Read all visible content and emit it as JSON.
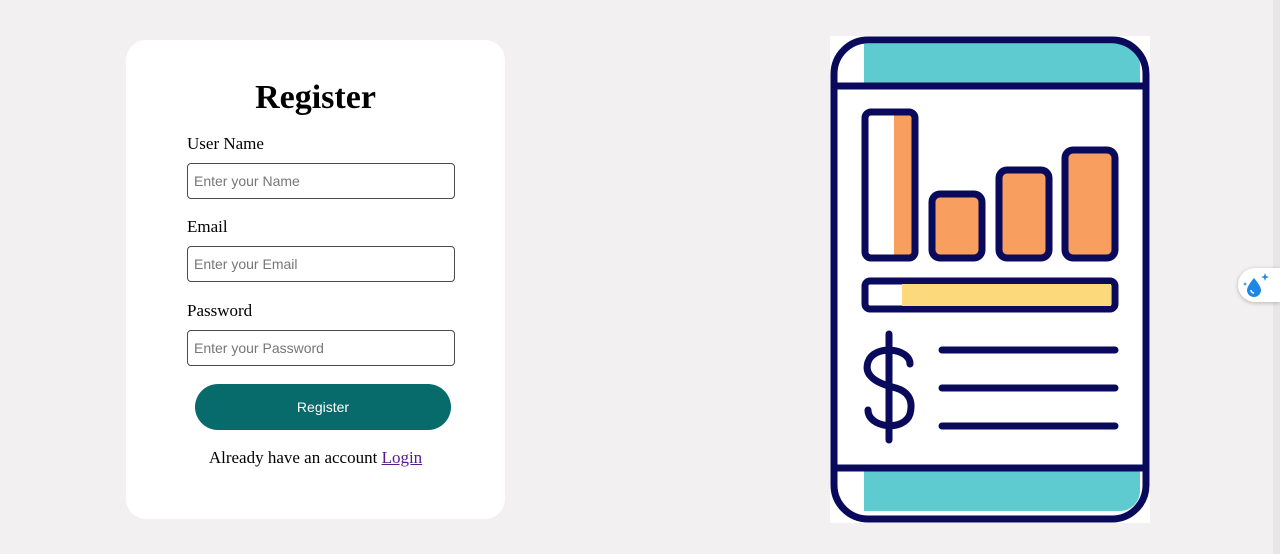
{
  "form": {
    "title": "Register",
    "username_label": "User Name",
    "username_placeholder": "Enter your Name",
    "email_label": "Email",
    "email_placeholder": "Enter your Email",
    "password_label": "Password",
    "password_placeholder": "Enter your Password",
    "submit_label": "Register",
    "login_prompt": "Already have an account",
    "login_link": "Login"
  },
  "illustration": {
    "icon": "financial-report-icon",
    "colors": {
      "outline": "#0a0a5c",
      "accent_teal": "#5ecbd1",
      "bar_orange": "#f89e5e",
      "progress_yellow": "#fcd97a"
    },
    "progress_fill": 0.86
  },
  "extension": {
    "icon": "water-drop-sparkle-icon"
  },
  "colors": {
    "page_background": "#f2f0f0",
    "card_background": "#ffffff",
    "button_background": "#076b6c",
    "link_color": "#551a8b"
  }
}
